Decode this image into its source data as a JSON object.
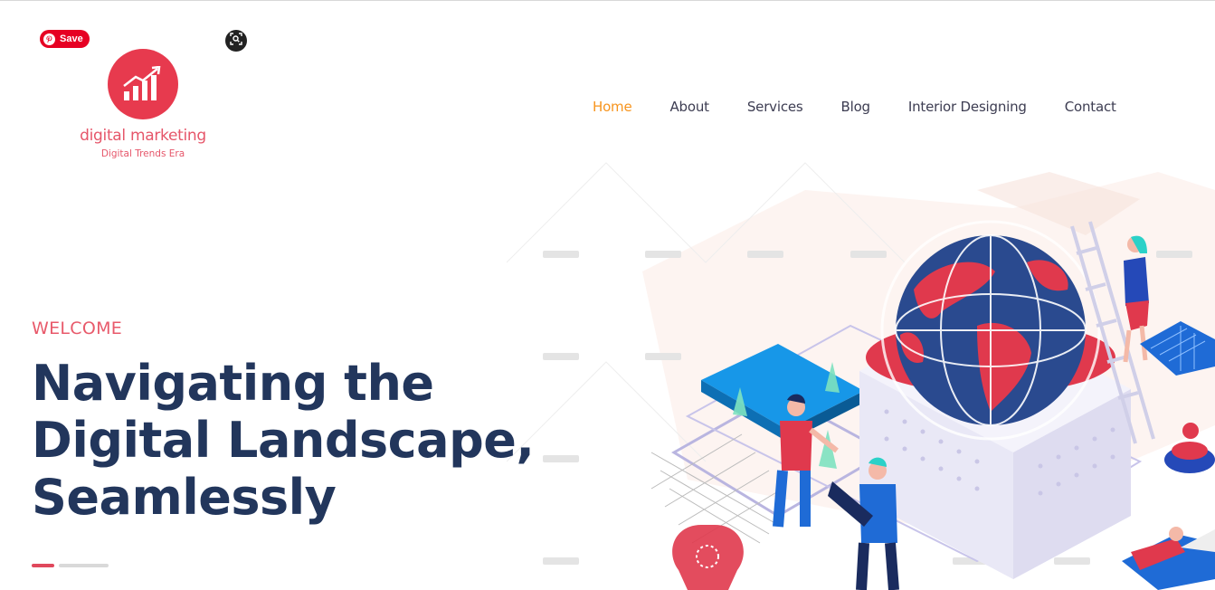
{
  "pinterest": {
    "save_label": "Save"
  },
  "logo": {
    "title": "digital marketing",
    "subtitle": "Digital Trends Era"
  },
  "nav": {
    "items": [
      {
        "label": "Home",
        "active": true
      },
      {
        "label": "About"
      },
      {
        "label": "Services"
      },
      {
        "label": "Blog"
      },
      {
        "label": "Interior Designing"
      },
      {
        "label": "Contact"
      }
    ]
  },
  "hero": {
    "eyebrow": "WELCOME",
    "headline_line1": "Navigating the",
    "headline_line2": "Digital Landscape,",
    "headline_line3": "Seamlessly"
  },
  "colors": {
    "brand": "#e73a4e",
    "nav_active": "#f7941d",
    "heading": "#22365c",
    "eyebrow": "#e85a6b"
  }
}
